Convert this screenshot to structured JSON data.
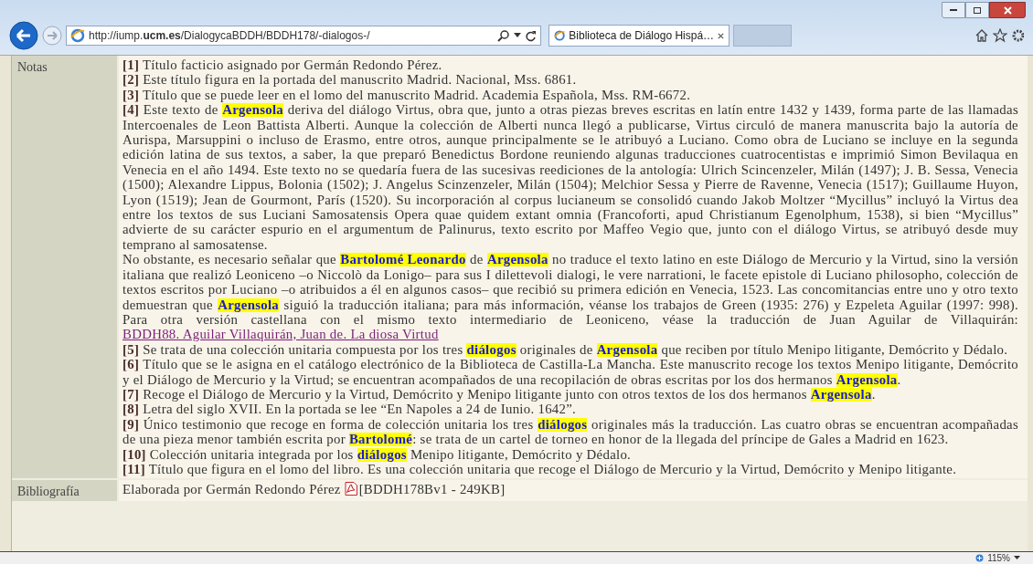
{
  "browser": {
    "address": {
      "prefix": "http://iump.",
      "domain": "ucm.es",
      "path": "/DialogycaBDDH/BDDH178/-dialogos-/"
    },
    "tabs": [
      {
        "title": "Biblioteca de Diálogo Hispá…",
        "selected": true
      }
    ]
  },
  "table": {
    "rows": [
      {
        "label": "Notas",
        "paragraphs": [
          [
            {
              "kind": "ref",
              "text": "[1]"
            },
            {
              "kind": "text",
              "text": " Título facticio asignado por Germán Redondo Pérez."
            }
          ],
          [
            {
              "kind": "ref",
              "text": "[2]"
            },
            {
              "kind": "text",
              "text": " Este título figura en la portada del manuscrito Madrid. Nacional, Mss. 6861."
            }
          ],
          [
            {
              "kind": "ref",
              "text": "[3]"
            },
            {
              "kind": "text",
              "text": " Título que se puede leer en el lomo del manuscrito Madrid. Academia Española, Mss. RM-6672."
            }
          ],
          [
            {
              "kind": "ref",
              "text": "[4]"
            },
            {
              "kind": "text",
              "text": " Este texto de "
            },
            {
              "kind": "term",
              "text": "Argensola"
            },
            {
              "kind": "text",
              "text": " deriva del diálogo Virtus, obra que, junto a otras piezas breves escritas en latín entre 1432 y 1439, forma parte de las llamadas Intercoenales de Leon Battista Alberti. Aunque la colección de Alberti nunca llegó a publicarse, Virtus circuló de manera manuscrita bajo la autoría de Aurispa, Marsuppini o incluso de Erasmo, entre otros, aunque principalmente se le atribuyó a Luciano. Como obra de Luciano se incluye en la segunda edición latina de sus textos, a saber, la que preparó Benedictus Bordone reuniendo algunas traducciones cuatrocentistas e imprimió Simon Bevilaqua en Venecia en el año 1494. Este texto no se quedaría fuera de las sucesivas reediciones de la antología: Ulrich Scincenzeler, Milán (1497); J. B. Sessa, Venecia (1500); Alexandre Lippus, Bolonia (1502); J. Angelus Scinzenzeler, Milán (1504); Melchior Sessa y Pierre de Ravenne, Venecia (1517); Guillaume Huyon, Lyon (1519); Jean de Gourmont, París (1520). Su incorporación al corpus lucianeum se consolidó cuando Jakob Moltzer “Mycillus” incluyó la Virtus dea entre los textos de sus Luciani Samosatensis Opera quae quidem extant omnia (Francoforti, apud Christianum Egenolphum, 1538), si bien “Mycillus” advierte de su carácter espurio en el argumentum de Palinurus, texto escrito por Maffeo Vegio que, junto con el diálogo Virtus, se atribuyó desde muy temprano al samosatense."
            }
          ],
          [
            {
              "kind": "text",
              "text": "No obstante, es necesario señalar que "
            },
            {
              "kind": "term",
              "text": "Bartolomé Leonardo"
            },
            {
              "kind": "text",
              "text": " de "
            },
            {
              "kind": "term",
              "text": "Argensola"
            },
            {
              "kind": "text",
              "text": " no traduce el texto latino en este Diálogo de Mercurio y la Virtud, sino la versión italiana que realizó Leoniceno –o Niccolò da Lonigo– para sus I dilettevoli dialogi, le vere narrationi, le facete epistole di Luciano philosopho, colección de textos escritos por Luciano –o atribuidos a él en algunos casos– que recibió su primera edición en Venecia, 1523. Las concomitancias entre uno y otro texto demuestran que "
            },
            {
              "kind": "term",
              "text": "Argensola"
            },
            {
              "kind": "text",
              "text": " siguió la traducción italiana; para más información, véanse los trabajos de Green (1935: 276) y Ezpeleta Aguilar (1997: 998). Para otra versión castellana con el mismo texto intermediario de Leoniceno, véase la traducción de Juan Aguilar de Villaquirán: "
            },
            {
              "kind": "link",
              "text": "BDDH88. Aguilar Villaquirán, Juan de. La diosa Virtud"
            }
          ],
          [
            {
              "kind": "ref",
              "text": "[5]"
            },
            {
              "kind": "text",
              "text": " Se trata de una colección unitaria compuesta por los tres "
            },
            {
              "kind": "term",
              "text": "diálogos"
            },
            {
              "kind": "text",
              "text": " originales de "
            },
            {
              "kind": "term",
              "text": "Argensola"
            },
            {
              "kind": "text",
              "text": " que reciben por título Menipo litigante, Demócrito y Dédalo."
            }
          ],
          [
            {
              "kind": "ref",
              "text": "[6]"
            },
            {
              "kind": "text",
              "text": " Título que se le asigna en el catálogo electrónico de la Biblioteca de Castilla-La Mancha. Este manuscrito recoge los textos Menipo litigante, Demócrito y el Diálogo de Mercurio y la Virtud; se encuentran acompañados de una recopilación de obras escritas por los dos hermanos "
            },
            {
              "kind": "term",
              "text": "Argensola"
            },
            {
              "kind": "text",
              "text": "."
            }
          ],
          [
            {
              "kind": "ref",
              "text": "[7]"
            },
            {
              "kind": "text",
              "text": " Recoge el Diálogo de Mercurio y la Virtud, Demócrito y Menipo litigante junto con otros textos de los dos hermanos "
            },
            {
              "kind": "term",
              "text": "Argensola"
            },
            {
              "kind": "text",
              "text": "."
            }
          ],
          [
            {
              "kind": "ref",
              "text": "[8]"
            },
            {
              "kind": "text",
              "text": " Letra del siglo XVII. En la portada se lee “En Napoles a 24 de Iunio. 1642”."
            }
          ],
          [
            {
              "kind": "ref",
              "text": "[9]"
            },
            {
              "kind": "text",
              "text": " Único testimonio que recoge en forma de colección unitaria los tres "
            },
            {
              "kind": "term",
              "text": "diálogos"
            },
            {
              "kind": "text",
              "text": " originales más la traducción. Las cuatro obras se encuentran acompañadas de una pieza menor también escrita por "
            },
            {
              "kind": "term",
              "text": "Bartolomé"
            },
            {
              "kind": "text",
              "text": ": se trata de un cartel de torneo en honor de la llegada del príncipe de Gales a Madrid en 1623."
            }
          ],
          [
            {
              "kind": "ref",
              "text": "[10]"
            },
            {
              "kind": "text",
              "text": " Colección unitaria integrada por los "
            },
            {
              "kind": "term",
              "text": "diálogos"
            },
            {
              "kind": "text",
              "text": " Menipo litigante, Demócrito y Dédalo."
            }
          ],
          [
            {
              "kind": "ref",
              "text": "[11]"
            },
            {
              "kind": "text",
              "text": " Título que figura en el lomo del libro. Es una colección unitaria que recoge el Diálogo de Mercurio y la Virtud, Demócrito y Menipo litigante."
            }
          ]
        ]
      },
      {
        "label": "Bibliografía",
        "paragraphs": [
          [
            {
              "kind": "text",
              "text": "Elaborada por Germán Redondo Pérez "
            },
            {
              "kind": "pdf",
              "text": "[BDDH178Bv1 - 249KB]"
            }
          ]
        ]
      }
    ]
  },
  "status_bar": {
    "zoom": "115%"
  }
}
